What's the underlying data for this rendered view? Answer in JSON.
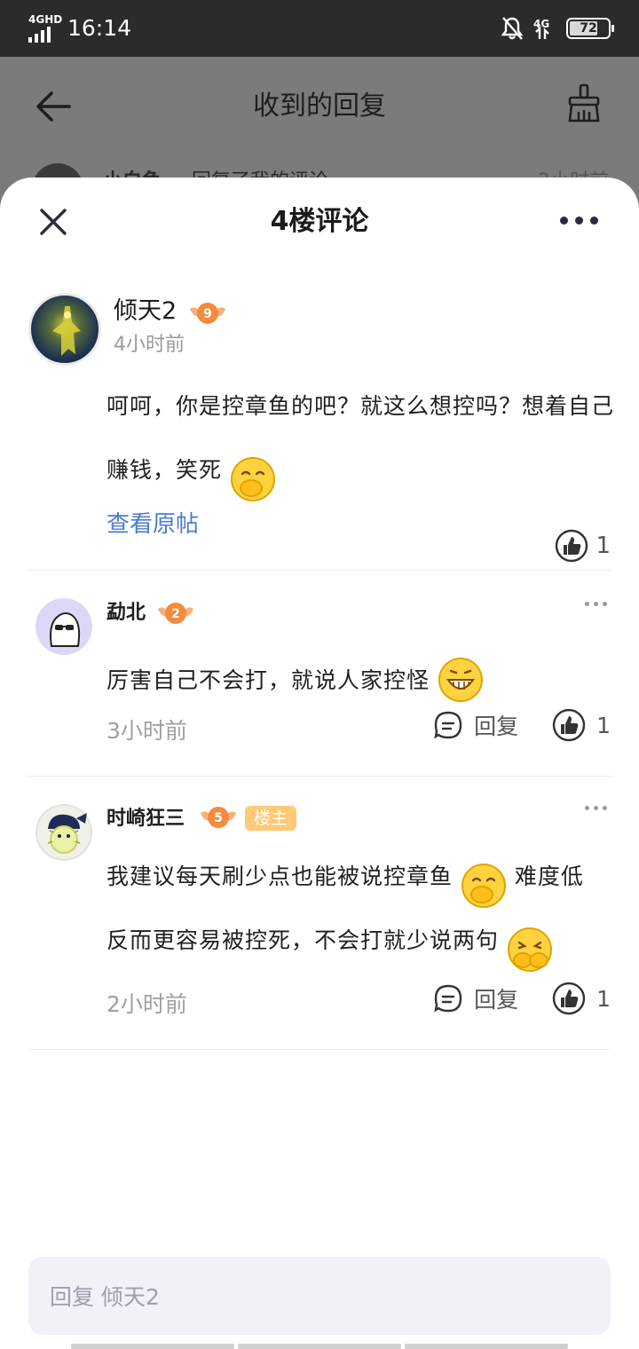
{
  "status_bar": {
    "network": "4GHD",
    "time": "16:14",
    "network_right": "4G",
    "battery": "72"
  },
  "background_page": {
    "title": "收到的回复",
    "peek_name": "小白鱼",
    "peek_action": "回复了我的评论",
    "peek_time": "2小时前"
  },
  "sheet": {
    "title": "4楼评论",
    "main_comment": {
      "author": "倾天2",
      "level": "9",
      "time": "4小时前",
      "text": "呵呵，你是控章鱼的吧？就这么想控吗？想着自己赚钱，笑死",
      "view_original": "查看原帖",
      "likes": "1"
    },
    "replies": [
      {
        "author": "勐北",
        "level": "2",
        "text": "厉害自己不会打，就说人家控怪",
        "time": "3小时前",
        "reply_label": "回复",
        "likes": "1"
      },
      {
        "author": "时崎狂三",
        "level": "5",
        "tag": "楼主",
        "text_line1": "我建议每天刷少点也能被说控章鱼",
        "text_line1b": "难度低",
        "text_line2": "反而更容易被控死，不会打就少说两句",
        "time": "2小时前",
        "reply_label": "回复",
        "likes": "1"
      }
    ],
    "reply_input_placeholder": "回复 倾天2"
  },
  "colors": {
    "accent_link": "#4b7bd1",
    "badge_orange": "#f48a3c",
    "host_tag": "#ffc977"
  },
  "icons": [
    "back-arrow-icon",
    "broom-icon",
    "close-icon",
    "more-icon",
    "like-icon",
    "comment-icon",
    "emoji-cover-mouth",
    "emoji-grin",
    "emoji-laugh-hide"
  ]
}
